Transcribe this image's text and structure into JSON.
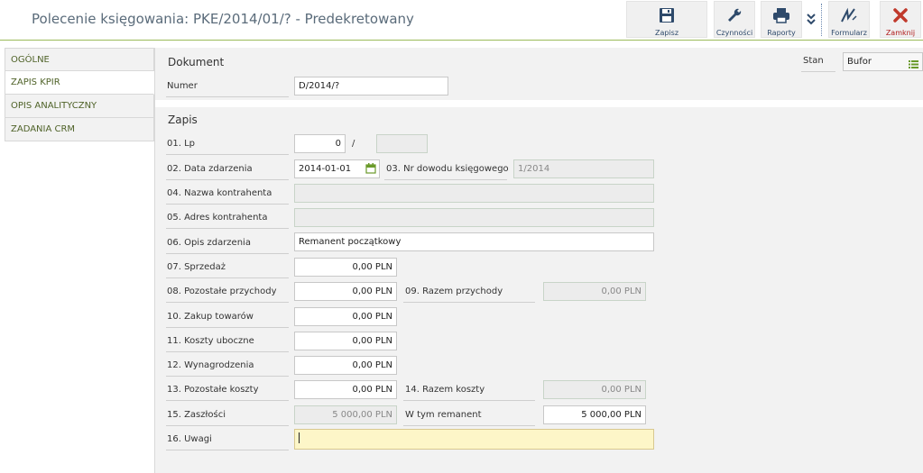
{
  "window": {
    "title": "Polecenie księgowania: PKE/2014/01/? - Predekretowany"
  },
  "toolbar": {
    "save": "Zapisz",
    "actions": "Czynności",
    "reports": "Raporty",
    "form": "Formularz",
    "close": "Zamknij"
  },
  "icons": {
    "save": "floppy-disk-icon",
    "actions": "wrench-icon",
    "reports": "printer-icon",
    "expand": "double-chevron-down-icon",
    "form": "signature-icon",
    "close": "close-x-icon",
    "calendar": "calendar-icon",
    "list": "list-icon"
  },
  "colors": {
    "accent_green": "#9bbb59",
    "sidebar_text": "#4f6228",
    "close_red": "#c0392b",
    "active_field": "#fdf6c8"
  },
  "sidebar": {
    "items": [
      {
        "label": "OGÓLNE",
        "active": false
      },
      {
        "label": "ZAPIS KPIR",
        "active": true
      },
      {
        "label": "OPIS ANALITYCZNY",
        "active": false
      },
      {
        "label": "ZADANIA CRM",
        "active": false
      }
    ]
  },
  "document": {
    "section_title": "Dokument",
    "numer_label": "Numer",
    "numer_value": "D/2014/?",
    "stan_label": "Stan",
    "stan_value": "Bufor"
  },
  "zapis": {
    "section_title": "Zapis",
    "lp_label": "01. Lp",
    "lp_value": "0",
    "lp_separator": "/",
    "lp_second": "",
    "data_label": "02. Data zdarzenia",
    "data_value": "2014-01-01",
    "nr_dowodu_label": "03. Nr dowodu księgowego",
    "nr_dowodu_value": "1/2014",
    "nazwa_label": "04. Nazwa kontrahenta",
    "nazwa_value": "",
    "adres_label": "05. Adres kontrahenta",
    "adres_value": "",
    "opis_label": "06. Opis zdarzenia",
    "opis_value": "Remanent początkowy",
    "sprzedaz_label": "07. Sprzedaż",
    "sprzedaz_value": "0,00 PLN",
    "pozostale_przych_label": "08. Pozostałe przychody",
    "pozostale_przych_value": "0,00 PLN",
    "razem_przych_label": "09. Razem przychody",
    "razem_przych_value": "0,00 PLN",
    "zakup_label": "10. Zakup towarów",
    "zakup_value": "0,00 PLN",
    "koszty_uboczne_label": "11. Koszty uboczne",
    "koszty_uboczne_value": "0,00 PLN",
    "wynagrodzenia_label": "12. Wynagrodzenia",
    "wynagrodzenia_value": "0,00 PLN",
    "pozostale_koszty_label": "13. Pozostałe koszty",
    "pozostale_koszty_value": "0,00 PLN",
    "razem_koszty_label": "14. Razem koszty",
    "razem_koszty_value": "0,00 PLN",
    "zaszlosci_label": "15. Zaszłości",
    "zaszlosci_value": "5 000,00 PLN",
    "remanent_label": "W tym remanent",
    "remanent_value": "5 000,00 PLN",
    "uwagi_label": "16. Uwagi",
    "uwagi_value": ""
  }
}
